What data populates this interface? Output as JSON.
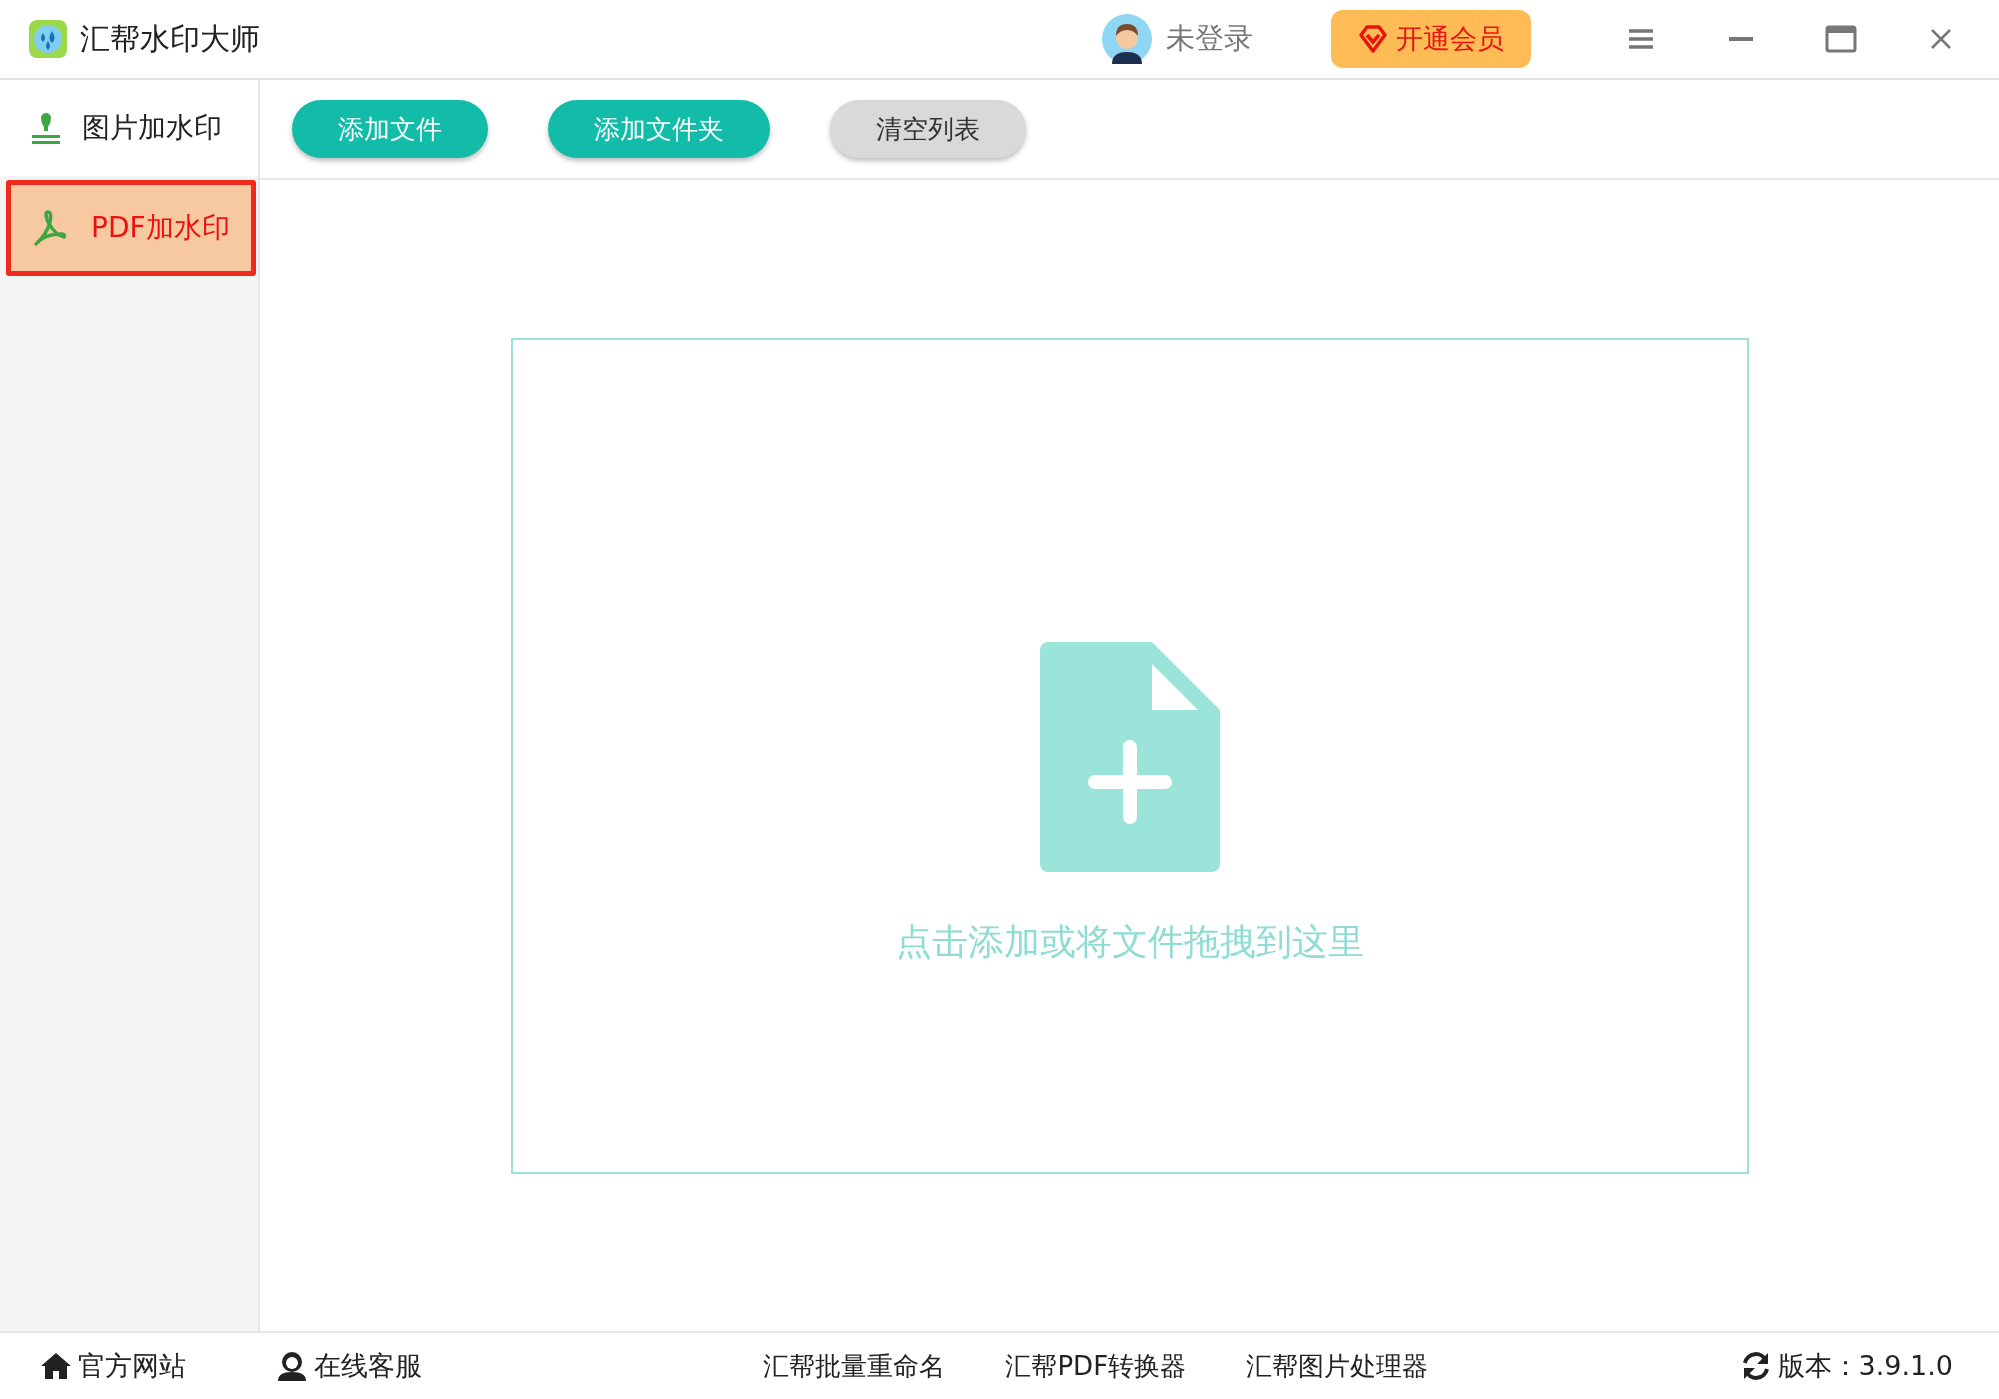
{
  "window": {
    "title": "汇帮水印大师"
  },
  "account": {
    "user": "未登录",
    "vip_button": "开通会员"
  },
  "sidebar": {
    "items": [
      {
        "label": "图片加水印",
        "kind": "stamp",
        "selected": false
      },
      {
        "label": "PDF加水印",
        "kind": "pdf",
        "selected": true
      }
    ]
  },
  "toolbar": {
    "buttons": [
      {
        "label": "添加文件",
        "kind": "primary"
      },
      {
        "label": "添加文件夹",
        "kind": "primary"
      },
      {
        "label": "清空列表",
        "kind": "secondary"
      }
    ]
  },
  "drop_zone": {
    "hint": "点击添加或将文件拖拽到这里"
  },
  "footer": {
    "left_links": [
      {
        "label": "官方网站",
        "kind": "home"
      },
      {
        "label": "在线客服",
        "kind": "support"
      }
    ],
    "products": [
      "汇帮批量重命名",
      "汇帮PDF转换器",
      "汇帮图片处理器"
    ],
    "version": "版本：3.9.1.0"
  }
}
